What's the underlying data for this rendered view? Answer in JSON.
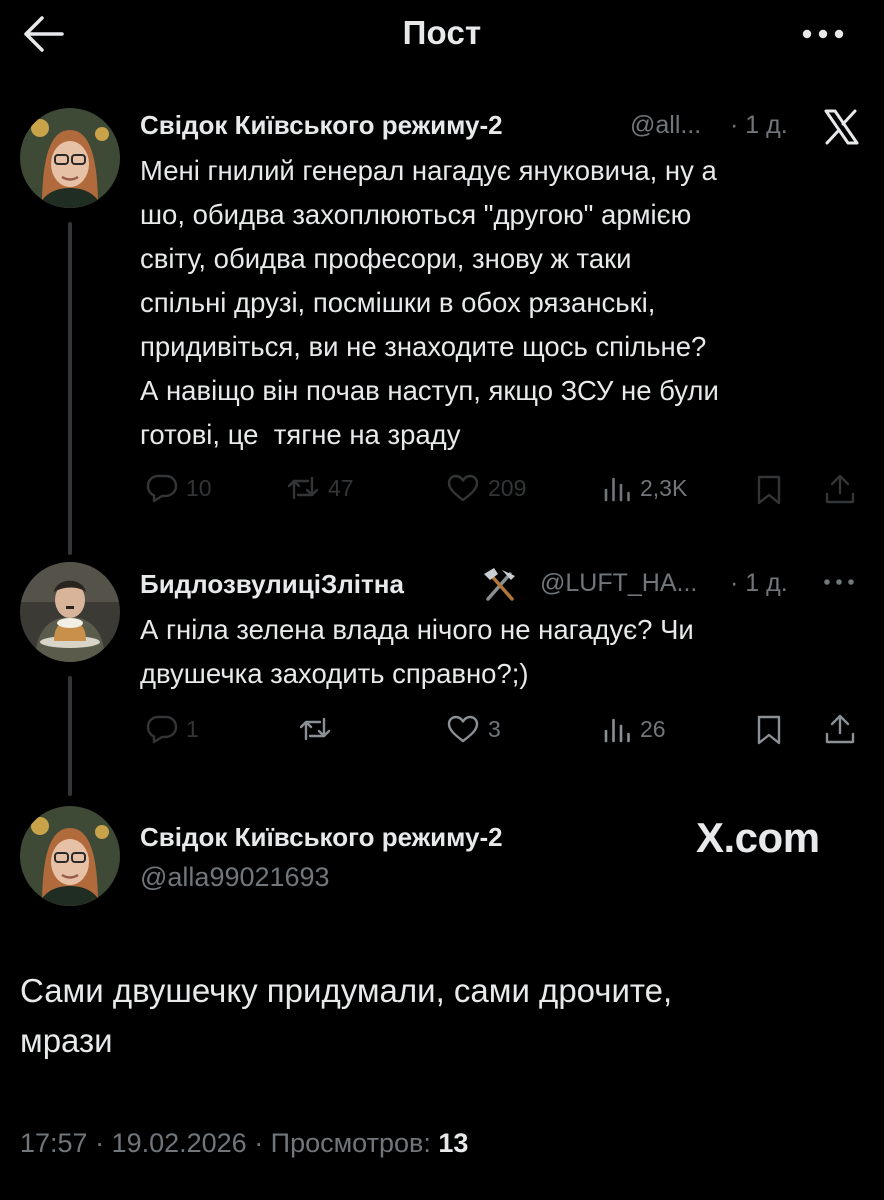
{
  "header": {
    "title": "Пост"
  },
  "tweet1": {
    "name": "Свідок Київського режиму-2",
    "handle": "@all...",
    "time": "· 1 д.",
    "text": "Мені гнилий генерал нагадує януковича, ну а\nшо, обидва захоплюються \"другою\" армією\nсвіту, обидва професори, знову ж таки\nспільні друзі, посмішки в обох рязанські,\nпридивіться, ви не знаходите щось спільне?\nА навіщо він почав наступ, якщо ЗСУ не були\nготові, це  тягне на зраду",
    "replies": "10",
    "reposts": "47",
    "likes": "209",
    "views": "2,3K"
  },
  "tweet2": {
    "name": "БидлозвулиціЗлітна",
    "name_emoji": "⚒",
    "handle": "@LUFT_HA...",
    "time": "· 1 д.",
    "text": "А гніла зелена влада нічого не нагадує? Чи\nдвушечка заходить справно?;)",
    "replies": "1",
    "likes": "3",
    "views": "26"
  },
  "main_post": {
    "name": "Свідок Київського режиму-2",
    "handle": "@alla99021693",
    "watermark": "X.com",
    "text": "Сами двушечку придумали, сами дрочите,\nмрази",
    "timestamp": "17:57 · 19.02.2026 · Просмотров:",
    "views": "13"
  },
  "icons": {
    "back": "arrow-left-icon",
    "more": "more-horizontal-icon",
    "x_logo": "x-logo-icon",
    "reply": "reply-icon",
    "repost": "repost-icon",
    "like": "heart-icon",
    "views": "views-icon",
    "bookmark": "bookmark-icon",
    "share": "share-icon"
  },
  "colors": {
    "background": "#000000",
    "text": "#e7e9ea",
    "secondary": "#71767b",
    "thread_line": "#333639"
  }
}
